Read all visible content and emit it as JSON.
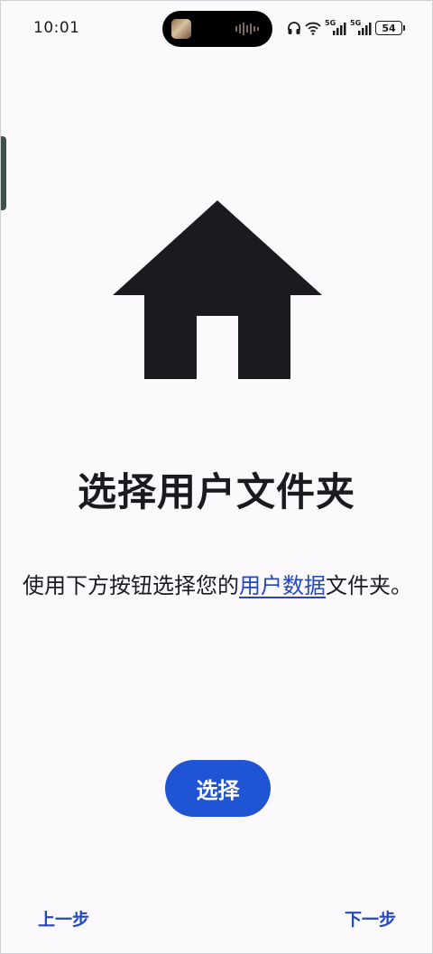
{
  "status_bar": {
    "time": "10:01",
    "network_1": "5G",
    "network_2": "5G",
    "battery": "54",
    "icons": [
      "headphones-icon",
      "wifi-icon",
      "signal-icon",
      "signal-icon",
      "battery-icon"
    ]
  },
  "illustration": {
    "icon": "home-icon",
    "color": "#1b1b1f"
  },
  "main": {
    "title": "选择用户文件夹",
    "description_before": "使用下方按钮选择您的",
    "description_link": "用户数据",
    "description_after": "文件夹。",
    "select_label": "选择"
  },
  "navigation": {
    "back_label": "上一步",
    "next_label": "下一步"
  },
  "colors": {
    "accent": "#1f55d4",
    "link": "#2148c0",
    "background": "#fcf9fd",
    "text": "#1b1b1f"
  }
}
